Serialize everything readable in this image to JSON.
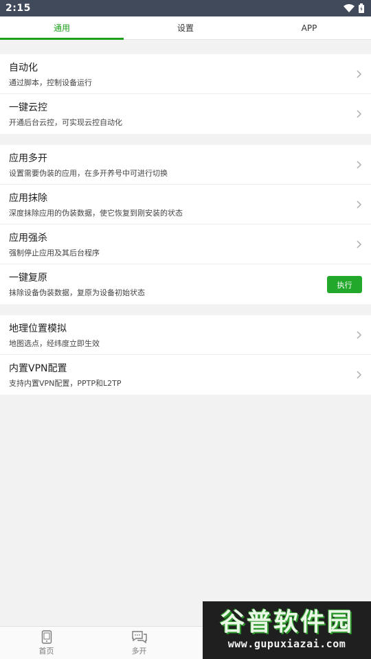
{
  "status_bar": {
    "time": "2:15"
  },
  "tabs": [
    {
      "label": "通用",
      "active": true
    },
    {
      "label": "设置",
      "active": false
    },
    {
      "label": "APP",
      "active": false
    }
  ],
  "groups": [
    {
      "items": [
        {
          "title": "自动化",
          "subtitle": "通过脚本，控制设备运行"
        },
        {
          "title": "一键云控",
          "subtitle": "开通后台云控，可实现云控自动化"
        }
      ]
    },
    {
      "items": [
        {
          "title": "应用多开",
          "subtitle": "设置需要伪装的应用，在多开养号中可进行切换"
        },
        {
          "title": "应用抹除",
          "subtitle": "深度抹除应用的伪装数据，使它恢复到刚安装的状态"
        },
        {
          "title": "应用强杀",
          "subtitle": "强制停止应用及其后台程序"
        },
        {
          "title": "一键复原",
          "subtitle": "抹除设备伪装数据，复原为设备初始状态",
          "button": "执行"
        }
      ]
    },
    {
      "items": [
        {
          "title": "地理位置模拟",
          "subtitle": "地图选点，经纬度立即生效"
        },
        {
          "title": "内置VPN配置",
          "subtitle": "支持内置VPN配置，PPTP和L2TP"
        }
      ]
    }
  ],
  "bottom_nav": [
    {
      "label": "首页",
      "icon": "phone-icon"
    },
    {
      "label": "多开",
      "icon": "chat-icon"
    }
  ],
  "watermark": {
    "title": "谷普软件园",
    "url": "www.gupuxiazai.com"
  },
  "colors": {
    "accent": "#1ca01c",
    "status_bar": "#414a5a",
    "button": "#22a82a"
  }
}
